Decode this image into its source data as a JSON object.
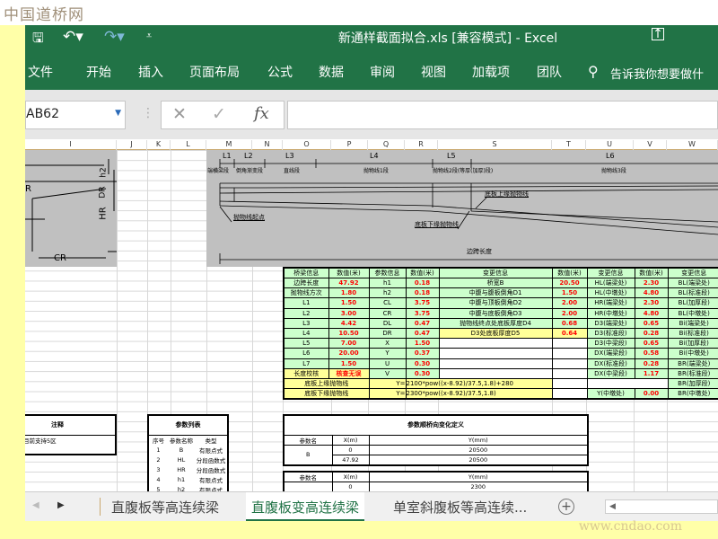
{
  "watermark_top": "中国道桥网",
  "watermark_bottom": "www.cndao.com",
  "titlebar": {
    "title": "新通样截面拟合.xls  [兼容模式]  -  Excel"
  },
  "ribbon": {
    "tabs": [
      "文件",
      "开始",
      "插入",
      "页面布局",
      "公式",
      "数据",
      "审阅",
      "视图",
      "加载项",
      "团队"
    ],
    "tell_me": "告诉我你想要做什"
  },
  "formula_bar": {
    "name_box": "AB62",
    "fx": "fx",
    "value": ""
  },
  "columns": [
    "I",
    "J",
    "K",
    "L",
    "M",
    "N",
    "O",
    "P",
    "Q",
    "R",
    "S",
    "T",
    "U",
    "V",
    "W"
  ],
  "drawing": {
    "left_labels": [
      "h2",
      "DR",
      "HR",
      "CR",
      "R"
    ],
    "segments": [
      "L1",
      "L2",
      "L3",
      "L4",
      "L5",
      "L6"
    ],
    "segment_names": [
      "端横梁段",
      "倒角渐变段",
      "直线段",
      "抛物线1段",
      "抛物线2段(等厚(加厚)段)",
      "抛物线3段"
    ],
    "callouts": [
      "底板上缘抛物线",
      "抛物线起点",
      "底板下缘抛物线",
      "边跨长度"
    ]
  },
  "main_table": {
    "header": [
      "桥梁信息",
      "数值(米)",
      "参数信息",
      "数值(米)",
      "变更信息",
      "数值(米)",
      "变更信息",
      "数值(米)",
      "变更信息"
    ],
    "rows": [
      [
        "边跨长度",
        "47.92",
        "h1",
        "0.18",
        "桥宽B",
        "20.50",
        "HL(端梁处)",
        "2.30",
        "BL(端梁处)"
      ],
      [
        "抛物线方次",
        "1.80",
        "h2",
        "0.18",
        "中腹与腹板倒角D1",
        "1.50",
        "HL(中墩处)",
        "4.80",
        "BL(标准段)"
      ],
      [
        "L1",
        "1.50",
        "CL",
        "3.75",
        "中腹与顶板倒角D2",
        "2.00",
        "HR(端梁处)",
        "2.30",
        "BL(加厚段)"
      ],
      [
        "L2",
        "3.00",
        "CR",
        "3.75",
        "中腹与底板倒角D3",
        "2.00",
        "HR(中墩处)",
        "4.80",
        "BL(中墩处)"
      ],
      [
        "L3",
        "4.42",
        "DL",
        "0.47",
        "抛物线终点处底板厚度D4",
        "0.68",
        "D3(端梁处)",
        "0.65",
        "Bi(端梁处)"
      ],
      [
        "L4",
        "10.50",
        "DR",
        "0.47",
        "D3处底板厚度D5",
        "0.64",
        "D3(标准段)",
        "0.28",
        "Bi(标准段)"
      ],
      [
        "L5",
        "7.00",
        "X",
        "1.50",
        "",
        "",
        "D3(中梁段)",
        "0.65",
        "Bi(加厚段)"
      ],
      [
        "L6",
        "20.00",
        "Y",
        "0.37",
        "",
        "",
        "DX(端梁段)",
        "0.58",
        "Bi(中墩处)"
      ],
      [
        "L7",
        "1.50",
        "U",
        "0.30",
        "",
        "",
        "DX(标准段)",
        "0.28",
        "BR(端梁处)"
      ],
      [
        "长度校核",
        "核查无误",
        "V",
        "0.30",
        "",
        "",
        "DX(中梁段)",
        "1.17",
        "BR(标准段)"
      ]
    ],
    "upper_parabola": {
      "label": "底板上缘抛物线",
      "eq": "Y=",
      "formula": "2100*pow((x-8.92)/37.5,1.8)+280",
      "right": "BR(加厚段)"
    },
    "lower_parabola": {
      "label": "底板下缘抛物线",
      "eq": "Y=",
      "formula": "2300*pow((x-8.92)/37.5,1.8)",
      "u": "Y(中墩处)",
      "v": "0.00",
      "right": "BR(中墩处)"
    }
  },
  "notes": {
    "title": "注释",
    "text": "的区宽，目前支持5区"
  },
  "param_list": {
    "title": "参数列表",
    "header": [
      "序号",
      "参数名称",
      "类型"
    ],
    "rows": [
      [
        "1",
        "B",
        "有限点式"
      ],
      [
        "2",
        "HL",
        "分段函数式"
      ],
      [
        "3",
        "HR",
        "分段函数式"
      ],
      [
        "4",
        "h1",
        "有限点式"
      ],
      [
        "5",
        "h2",
        "有限点式"
      ]
    ]
  },
  "param_def": {
    "title": "参数顺桥向变化定义",
    "header": [
      "参数名",
      "X(m)",
      "Y(mm)"
    ],
    "b": {
      "name": "B",
      "rows": [
        [
          "0",
          "20500"
        ],
        [
          "47.92",
          "20500"
        ]
      ]
    },
    "header2": [
      "参数名",
      "X(m)",
      "Y(mm)"
    ],
    "row2": [
      "0",
      "2300"
    ]
  },
  "sheet_tabs": [
    "直腹板等高连续梁",
    "直腹板变高连续梁",
    "单室斜腹板等高连续..."
  ],
  "active_tab": 1,
  "colors": {
    "excel_green": "#217346",
    "cell_green": "#ccffcc",
    "cell_yellow": "#ffff99",
    "value_red": "#ff0000"
  }
}
